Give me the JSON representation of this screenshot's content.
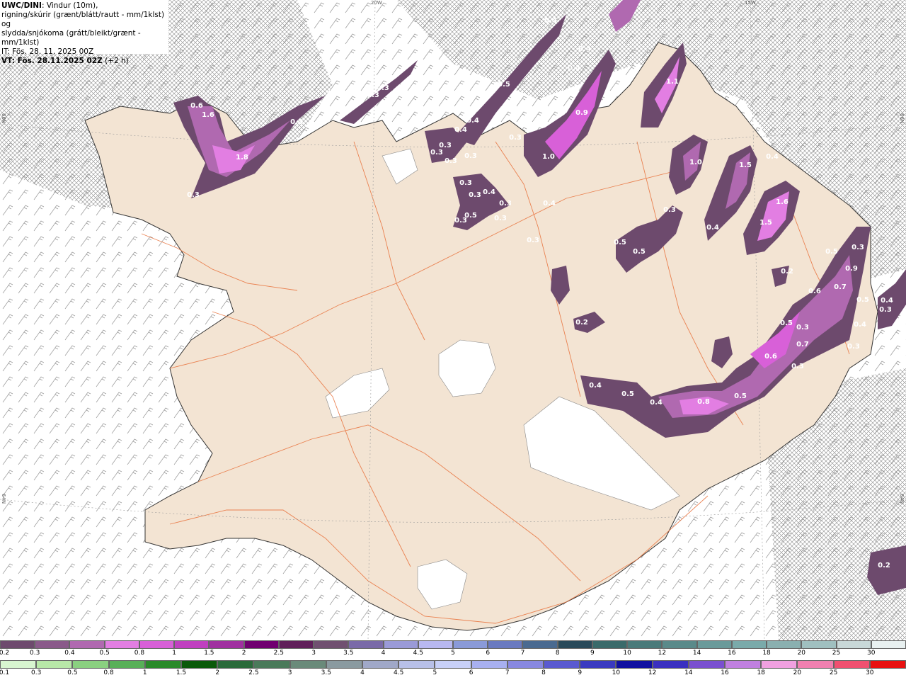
{
  "header": {
    "model": "UWC/DINI",
    "line1_rest": ": Vindur (10m),",
    "line2": "rigning/skúrir (grænt/blátt/rautt - mm/1klst) og",
    "line3": "slydda/snjókoma (grátt/bleikt/grænt - mm/1klst)",
    "line4": "IT: Fös. 28. 11. 2025 00Z",
    "line5_bold": "VT: Fös. 28.11.2025 02Z",
    "line5_rest": " (+2 h)"
  },
  "graticule": {
    "lon_20w": "20W",
    "lon_15w": "15W",
    "lat_66n": "66N",
    "lat_65n": "65N",
    "lat_64n": "64N"
  },
  "legend": {
    "snow_ticks": [
      "0.2",
      "0.3",
      "0.4",
      "0.5",
      "0.8",
      "1",
      "1.5",
      "2",
      "2.5",
      "3",
      "3.5",
      "4",
      "4.5",
      "5",
      "6",
      "7",
      "8",
      "9",
      "10",
      "12",
      "14",
      "16",
      "18",
      "20",
      "25",
      "30"
    ],
    "snow_colors": [
      "#6d4a6d",
      "#8a5a8a",
      "#b069b0",
      "#e27ee2",
      "#d860d8",
      "#c040c0",
      "#a030a0",
      "#700070",
      "#60205a",
      "#705070",
      "#7a6aa8",
      "#9a9ad8",
      "#b8b8f0",
      "#8a9ad8",
      "#6a7ac0",
      "#4a6a90",
      "#2a4a5a",
      "#3a6a6a",
      "#4a7a7a",
      "#5a8a8a",
      "#6a9a9a",
      "#7aaaaa",
      "#8ab0b0",
      "#a0c0c0",
      "#c8d8d8",
      "#e8f0f0"
    ],
    "rain_ticks": [
      "0.1",
      "0.3",
      "0.5",
      "0.8",
      "1",
      "1.5",
      "2",
      "2.5",
      "3",
      "3.5",
      "4",
      "4.5",
      "5",
      "6",
      "7",
      "8",
      "9",
      "10",
      "12",
      "14",
      "16",
      "18",
      "20",
      "25",
      "30"
    ],
    "rain_colors": [
      "#d8f5d0",
      "#b8e8a8",
      "#8ad080",
      "#58b058",
      "#2a8a2a",
      "#0a5a0a",
      "#2a6a3a",
      "#4a7a5a",
      "#6a8a7a",
      "#8a9aa0",
      "#a0a8c8",
      "#b8c0e8",
      "#c8d0f8",
      "#a8b0f0",
      "#8888e0",
      "#5a5ad0",
      "#3a3ac0",
      "#1010a0",
      "#3a30c0",
      "#7a50d0",
      "#c080e0",
      "#f0a0e0",
      "#f080b0",
      "#f05070",
      "#e81010"
    ]
  },
  "precip_labels": [
    {
      "v": "0.4"
    },
    {
      "v": "0.4"
    },
    {
      "v": "0.4"
    },
    {
      "v": "0.3"
    },
    {
      "v": "0.3"
    },
    {
      "v": "0.5"
    },
    {
      "v": "0.6"
    },
    {
      "v": "1.6"
    },
    {
      "v": "0.4"
    },
    {
      "v": "1.8"
    },
    {
      "v": "0.3"
    },
    {
      "v": "1.1"
    },
    {
      "v": "0.9"
    },
    {
      "v": "0.4"
    },
    {
      "v": "0.4"
    },
    {
      "v": "0.3"
    },
    {
      "v": "0.3"
    },
    {
      "v": "0.3"
    },
    {
      "v": "0.3"
    },
    {
      "v": "1.0"
    },
    {
      "v": "0.3"
    },
    {
      "v": "1.0"
    },
    {
      "v": "1.5"
    },
    {
      "v": "0.4"
    },
    {
      "v": "0.3"
    },
    {
      "v": "0.3"
    },
    {
      "v": "0.4"
    },
    {
      "v": "0.5"
    },
    {
      "v": "0.3"
    },
    {
      "v": "0.3"
    },
    {
      "v": "0.4"
    },
    {
      "v": "0.3"
    },
    {
      "v": "1.6"
    },
    {
      "v": "1.5"
    },
    {
      "v": "0.4"
    },
    {
      "v": "0.3"
    },
    {
      "v": "0.5"
    },
    {
      "v": "0.5"
    },
    {
      "v": "0.3"
    },
    {
      "v": "0.2"
    },
    {
      "v": "0.2"
    },
    {
      "v": "0.5"
    },
    {
      "v": "0.3"
    },
    {
      "v": "0.9"
    },
    {
      "v": "0.6"
    },
    {
      "v": "0.7"
    },
    {
      "v": "0.5"
    },
    {
      "v": "0.4"
    },
    {
      "v": "0.3"
    },
    {
      "v": "0.5"
    },
    {
      "v": "0.3"
    },
    {
      "v": "0.7"
    },
    {
      "v": "0.4"
    },
    {
      "v": "0.3"
    },
    {
      "v": "0.6"
    },
    {
      "v": "0.3"
    },
    {
      "v": "0.4"
    },
    {
      "v": "0.5"
    },
    {
      "v": "0.4"
    },
    {
      "v": "0.8"
    },
    {
      "v": "0.5"
    },
    {
      "v": "0.2"
    }
  ]
}
